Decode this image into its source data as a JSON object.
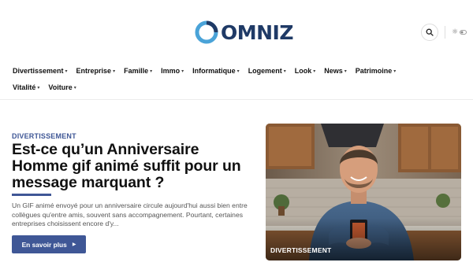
{
  "brand": {
    "name": "OMNIZ"
  },
  "colors": {
    "accent": "#3f5796",
    "brand_dark": "#1f3a66",
    "brand_light": "#4aa3d8"
  },
  "header": {
    "search_icon": "search-icon",
    "mode_icon": "sun-icon"
  },
  "nav": {
    "rows": [
      [
        {
          "label": "Divertissement"
        },
        {
          "label": "Entreprise"
        },
        {
          "label": "Famille"
        },
        {
          "label": "Immo"
        },
        {
          "label": "Informatique"
        },
        {
          "label": "Logement"
        },
        {
          "label": "Look"
        },
        {
          "label": "News"
        },
        {
          "label": "Patrimoine"
        }
      ],
      [
        {
          "label": "Vitalité"
        },
        {
          "label": "Voiture"
        }
      ]
    ]
  },
  "hero": {
    "category": "DIVERTISSEMENT",
    "title": "Est-ce qu’un Anniversaire Homme gif animé suffit pour un message marquant ?",
    "excerpt": "Un GIF animé envoyé pour un anniversaire circule aujourd'hui aussi bien entre collègues qu'entre amis, souvent sans accompagnement. Pourtant, certaines entreprises choisissent encore d'y...",
    "cta_label": "En savoir plus",
    "image_label": "DIVERTISSEMENT"
  }
}
